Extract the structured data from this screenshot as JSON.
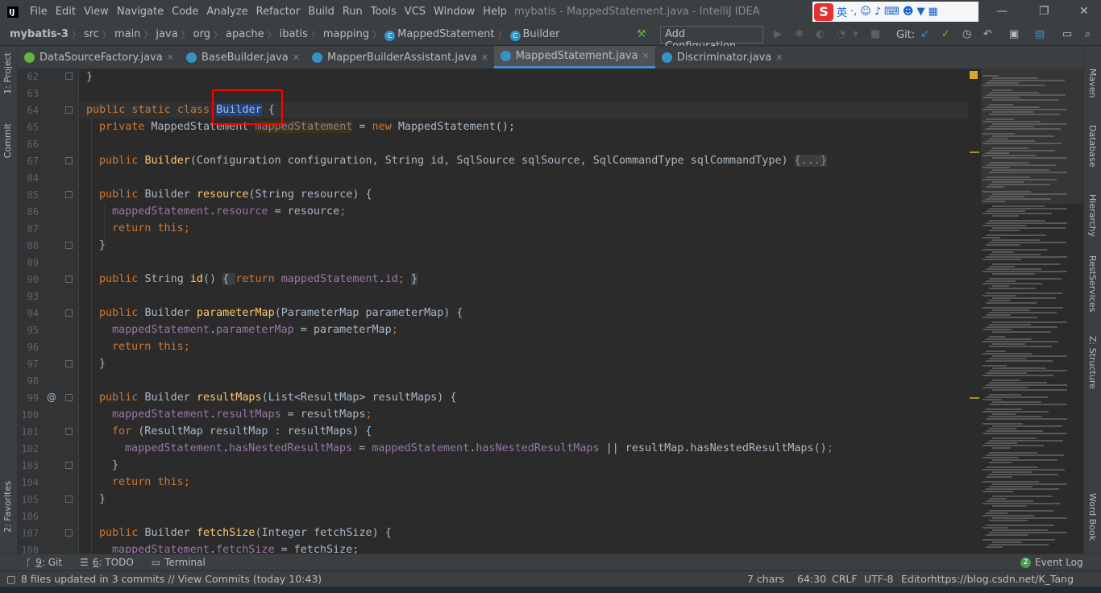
{
  "menubar": {
    "app_logo": "IJ",
    "items": [
      "File",
      "Edit",
      "View",
      "Navigate",
      "Code",
      "Analyze",
      "Refactor",
      "Build",
      "Run",
      "Tools",
      "VCS",
      "Window",
      "Help"
    ],
    "window_title": "mybatis - MappedStatement.java - IntelliJ IDEA",
    "ime_label": "英"
  },
  "navbar": {
    "crumbs": [
      "mybatis-3",
      "src",
      "main",
      "java",
      "org",
      "apache",
      "ibatis",
      "mapping",
      "MappedStatement",
      "Builder"
    ],
    "add_configuration": "Add Configuration...",
    "git_label": "Git:"
  },
  "tabs": [
    {
      "label": "DataSourceFactory.java",
      "icon": "interface-icon",
      "active": false
    },
    {
      "label": "BaseBuilder.java",
      "icon": "class-icon",
      "active": false
    },
    {
      "label": "MapperBuilderAssistant.java",
      "icon": "class-icon",
      "active": false
    },
    {
      "label": "MappedStatement.java",
      "icon": "class-icon",
      "active": true
    },
    {
      "label": "Discriminator.java",
      "icon": "class-icon",
      "active": false
    }
  ],
  "left_tools": {
    "project": "1: Project",
    "commit": "Commit",
    "favorites": "2: Favorites"
  },
  "right_tools": {
    "maven": "Maven",
    "database": "Database",
    "hierarchy": "Hierarchy",
    "rest": "RestServices",
    "structure": "Z: Structure",
    "wordbook": "Word Book"
  },
  "editor": {
    "line_numbers": [
      "62",
      "63",
      "64",
      "65",
      "66",
      "67",
      "84",
      "85",
      "86",
      "87",
      "88",
      "89",
      "90",
      "93",
      "94",
      "95",
      "96",
      "97",
      "98",
      "99",
      "100",
      "101",
      "102",
      "103",
      "104",
      "105",
      "106",
      "107",
      "108"
    ],
    "selected_word": "Builder",
    "code": {
      "l62": "}",
      "l64_a": "public static class ",
      "l64_sel": "Builder",
      "l64_b": " {",
      "l65_kw": "private ",
      "l65_type": "MappedStatement ",
      "l65_field": "mappedStatement",
      "l65_rest": " = ",
      "l65_new": "new ",
      "l65_end": "MappedStatement();",
      "l67_kw": "public ",
      "l67_fn": "Builder",
      "l67_params": "(Configuration configuration, String id, SqlSource sqlSource, SqlCommandType sqlCommandType) ",
      "l67_fold": "{...}",
      "l85_kw": "public ",
      "l85_type": "Builder ",
      "l85_fn": "resource",
      "l85_rest": "(String resource) {",
      "l86_f1": "mappedStatement",
      "l86_dot": ".",
      "l86_f2": "resource",
      "l86_rest": " = resource",
      "l86_semi": ";",
      "l87_kw": "return ",
      "l87_this": "this",
      "l87_semi": ";",
      "close": "}",
      "l90_kw": "public ",
      "l90_type": "String ",
      "l90_fn": "id",
      "l90_paren": "() ",
      "l90_ob": "{ ",
      "l90_ret": "return ",
      "l90_f1": "mappedStatement",
      "l90_dot": ".",
      "l90_f2": "id",
      "l90_semi": "; ",
      "l90_cb": "}",
      "l94_fn": "parameterMap",
      "l94_rest": "(ParameterMap parameterMap) {",
      "l95_f2": "parameterMap",
      "l95_rest": " = parameterMap",
      "l99_fn": "resultMaps",
      "l99_rest": "(List<ResultMap> resultMaps) {",
      "l100_f2": "resultMaps",
      "l100_rest": " = resultMaps",
      "l101_kw": "for ",
      "l101_rest": "(ResultMap resultMap : resultMaps) {",
      "l102_f2": "hasNestedResultMaps",
      "l102_eq": " = ",
      "l102_or": " || resultMap.hasNestedResultMaps()",
      "l107_fn": "fetchSize",
      "l107_rest": "(Integer fetchSize) {",
      "l108_f2": "fetchSize",
      "l108_rest": " = fetchSize;"
    }
  },
  "bottom_tools": {
    "git_num": "9",
    "git": ": Git",
    "todo_num": "6",
    "todo": ": TODO",
    "terminal": "Terminal",
    "event_log_count": "2",
    "event_log": "Event Log"
  },
  "status": {
    "message": "8 files updated in 3 commits // View Commits (today 10:43)",
    "chars": "7 chars",
    "position": "64:30",
    "line_sep": "CRLF",
    "encoding": "UTF-8",
    "watermark": "Editorhttps://blog.csdn.net/K_Tang"
  }
}
